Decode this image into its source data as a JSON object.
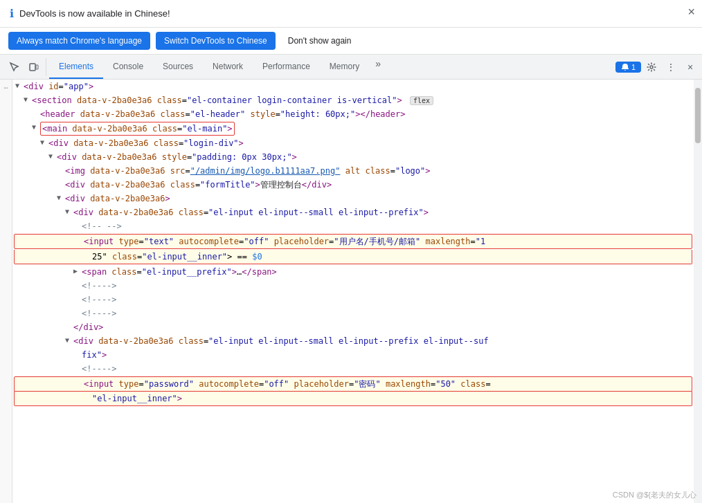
{
  "infoBanner": {
    "icon": "ℹ",
    "text": "DevTools is now available in Chinese!",
    "closeLabel": "×"
  },
  "buttonBar": {
    "alwaysMatchBtn": "Always match Chrome's language",
    "switchBtn": "Switch DevTools to Chinese",
    "dontShowBtn": "Don't show again"
  },
  "toolbar": {
    "inspectIcon": "⬚",
    "deviceIcon": "📱",
    "tabs": [
      {
        "label": "Elements",
        "active": true
      },
      {
        "label": "Console",
        "active": false
      },
      {
        "label": "Sources",
        "active": false
      },
      {
        "label": "Network",
        "active": false
      },
      {
        "label": "Performance",
        "active": false
      },
      {
        "label": "Memory",
        "active": false
      }
    ],
    "moreIcon": "»",
    "notificationCount": "1",
    "gearIcon": "⚙",
    "dotsIcon": "⋮",
    "closeIcon": "×"
  },
  "code": {
    "lines": [
      {
        "indent": 1,
        "triangle": "open",
        "html": "<span class='tag'>&lt;div id=\"app\"&gt;</span>"
      },
      {
        "indent": 2,
        "triangle": "open",
        "html": "<span class='tag'>&lt;section</span> <span class='attr-name'>data-v-2ba0e3a6</span> <span class='attr-name'>class</span>=<span class='attr-value'>\"el-container login-container is-vertical\"</span><span class='tag'>&gt;</span><span class='badge-flex-span'>flex</span>"
      },
      {
        "indent": 3,
        "triangle": "none",
        "html": "<span class='tag'>&lt;header</span> <span class='attr-name'>data-v-2ba0e3a6</span> <span class='attr-name'>class</span>=<span class='attr-value'>\"el-header\"</span> <span class='attr-name'>style</span>=<span class='attr-value'>\"height: 60px;\"</span><span class='tag'>&gt;&lt;/header&gt;</span>"
      },
      {
        "indent": 3,
        "triangle": "open",
        "html": "<span class='tag'>&lt;main</span> <span class='attr-name'>data-v-2ba0e3a6</span> <span class='attr-name'>class</span>=<span class='attr-value'>\"el-main\"</span><span class='tag'>&gt;</span>",
        "redBox": true
      },
      {
        "indent": 4,
        "triangle": "open",
        "html": "<span class='tag'>&lt;div</span> <span class='attr-name'>data-v-2ba0e3a6</span> <span class='attr-name'>class</span>=<span class='attr-value'>\"login-div\"</span><span class='tag'>&gt;</span>"
      },
      {
        "indent": 5,
        "triangle": "open",
        "html": "<span class='tag'>&lt;div</span> <span class='attr-name'>data-v-2ba0e3a6</span> <span class='attr-name'>style</span>=<span class='attr-value'>\"padding: 0px 30px;\"</span><span class='tag'>&gt;</span>"
      },
      {
        "indent": 6,
        "triangle": "none",
        "html": "<span class='tag'>&lt;img</span> <span class='attr-name'>data-v-2ba0e3a6</span> <span class='attr-name'>src</span>=<span class='attr-value-link'>\"/admin/img/logo.b1111aa7.png\"</span> <span class='attr-name'>alt</span> <span class='attr-name'>class</span>=<span class='attr-value'>\"logo\"</span><span class='tag'>&gt;</span>"
      },
      {
        "indent": 6,
        "triangle": "none",
        "html": "<span class='tag'>&lt;div</span> <span class='attr-name'>data-v-2ba0e3a6</span> <span class='attr-name'>class</span>=<span class='attr-value'>\"formTitle\"</span><span class='tag'>&gt;</span><span class='text-content'>管理控制台</span><span class='tag'>&lt;/div&gt;</span>"
      },
      {
        "indent": 6,
        "triangle": "open",
        "html": "<span class='tag'>&lt;div</span> <span class='attr-name'>data-v-2ba0e3a6</span><span class='tag'>&gt;</span>"
      },
      {
        "indent": 7,
        "triangle": "open",
        "html": "<span class='tag'>&lt;div</span> <span class='attr-name'>data-v-2ba0e3a6</span> <span class='attr-name'>class</span>=<span class='attr-value'>\"el-input el-input--small el-input--prefix\"</span><span class='tag'>&gt;</span>"
      },
      {
        "indent": 8,
        "triangle": "none",
        "html": "<span class='comment'>&lt;!-- --&gt;</span>"
      },
      {
        "indent": 8,
        "triangle": "none",
        "html": "<span class='tag'>&lt;input</span> <span class='attr-name'>type</span>=<span class='attr-value'>\"text\"</span> <span class='attr-name'>autocomplete</span>=<span class='attr-value'>\"off\"</span> <span class='attr-name'>placeholder</span>=<span class='attr-value'>\"用户名/手机号/邮箱\"</span> <span class='attr-name'>maxlength</span>=<span class='attr-value'>\"1</span>",
        "inputHighlight": true,
        "continued": true
      },
      {
        "indent": 8,
        "triangle": "none",
        "html": "25\" <span class='attr-name'>class</span>=<span class='attr-value'>\"el-input__inner\"</span>&gt; == <span style='color:#1a73e8'>$0</span>",
        "inputHighlight": true,
        "continued2": true
      },
      {
        "indent": 8,
        "triangle": "closed",
        "html": "<span class='tag'>&lt;span</span> <span class='attr-name'>class</span>=<span class='attr-value'>\"el-input__prefix\"</span><span class='tag'>&gt;</span><span class='text-content'>…</span><span class='tag'>&lt;/span&gt;</span>"
      },
      {
        "indent": 8,
        "triangle": "none",
        "html": "<span class='comment'>&lt;!----&gt;</span>"
      },
      {
        "indent": 8,
        "triangle": "none",
        "html": "<span class='comment'>&lt;!----&gt;</span>"
      },
      {
        "indent": 8,
        "triangle": "none",
        "html": "<span class='comment'>&lt;!----&gt;</span>"
      },
      {
        "indent": 7,
        "triangle": "none",
        "html": "<span class='tag'>&lt;/div&gt;</span>"
      },
      {
        "indent": 7,
        "triangle": "open",
        "html": "<span class='tag'>&lt;div</span> <span class='attr-name'>data-v-2ba0e3a6</span> <span class='attr-name'>class</span>=<span class='attr-value'>\"el-input el-input--small el-input--prefix el-input--suf</span>"
      },
      {
        "indent": 7,
        "triangle": "none",
        "html": "<span class='attr-value'>fix\"</span><span class='tag'>&gt;</span>"
      },
      {
        "indent": 8,
        "triangle": "none",
        "html": "<span class='comment'>&lt;!----&gt;</span>"
      },
      {
        "indent": 8,
        "triangle": "none",
        "html": "<span class='tag'>&lt;input</span> <span class='attr-name'>type</span>=<span class='attr-value'>\"password\"</span> <span class='attr-name'>autocomplete</span>=<span class='attr-value'>\"off\"</span> <span class='attr-name'>placeholder</span>=<span class='attr-value'>\"密码\"</span> <span class='attr-name'>maxlength</span>=<span class='attr-value'>\"50\"</span> <span class='attr-name'>class</span>=",
        "inputHighlight2": true
      },
      {
        "indent": 8,
        "triangle": "none",
        "html": "<span class='attr-value'>\"el-input__inner\"</span><span class='tag'>&gt;</span>",
        "inputHighlight2": true,
        "continued3": true
      }
    ]
  },
  "watermark": "CSDN @${老夫的女儿心"
}
